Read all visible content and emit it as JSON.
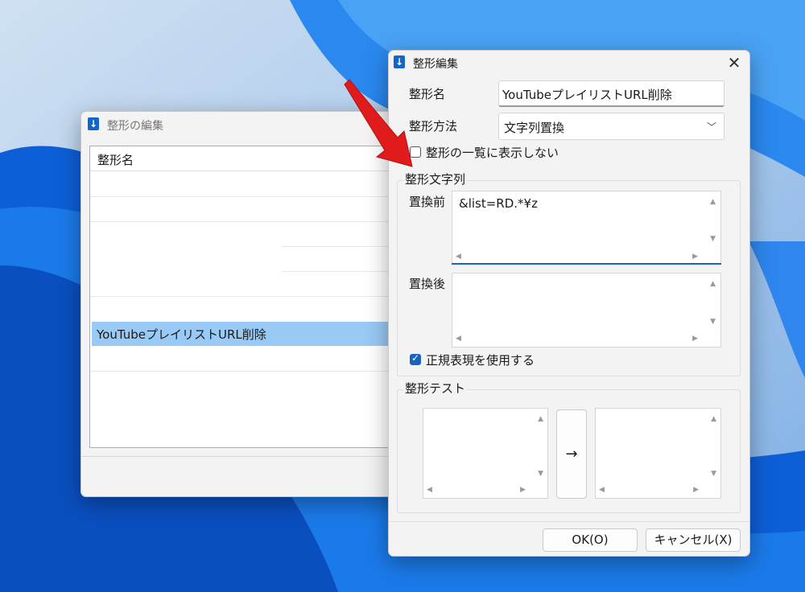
{
  "back_window": {
    "title": "整形の編集",
    "list_header": "整形名",
    "selected_item": "YouTubeプレイリストURL削除"
  },
  "dialog": {
    "title": "整形編集",
    "name_label": "整形名",
    "name_value": "YouTubeプレイリストURL削除",
    "method_label": "整形方法",
    "method_value": "文字列置換",
    "hide_label": "整形の一覧に表示しない",
    "group_string_title": "整形文字列",
    "before_label": "置換前",
    "before_value": "&list=RD.*¥z",
    "after_label": "置換後",
    "after_value": "",
    "regex_label": "正規表現を使用する",
    "group_test_title": "整形テスト",
    "arrow_label": "→",
    "ok_label": "OK(O)",
    "cancel_label": "キャンセル(X)"
  },
  "colors": {
    "accent": "#1a64c0",
    "selection": "#99c9f5",
    "annotation_arrow": "#e11b1b"
  }
}
